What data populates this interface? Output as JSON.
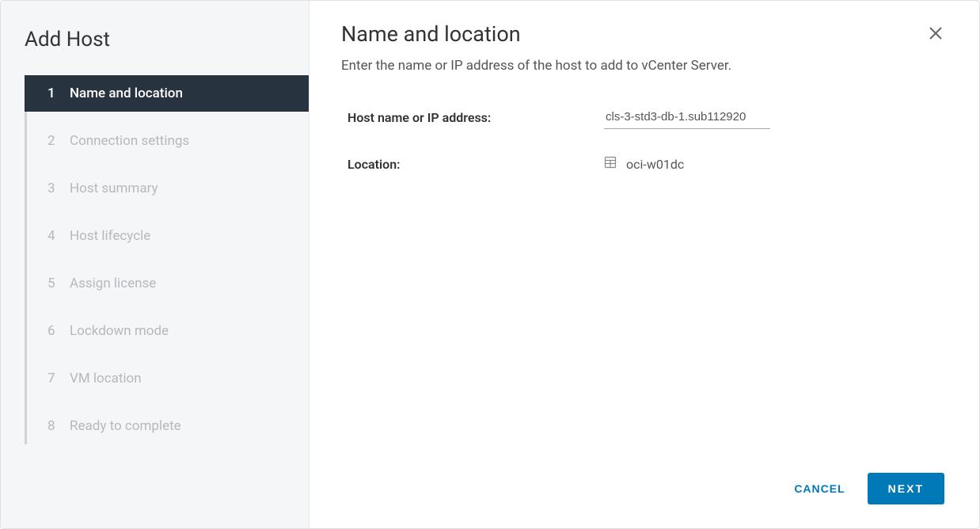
{
  "sidebar": {
    "title": "Add Host",
    "steps": [
      {
        "num": "1",
        "label": "Name and location",
        "active": true
      },
      {
        "num": "2",
        "label": "Connection settings",
        "active": false
      },
      {
        "num": "3",
        "label": "Host summary",
        "active": false
      },
      {
        "num": "4",
        "label": "Host lifecycle",
        "active": false
      },
      {
        "num": "5",
        "label": "Assign license",
        "active": false
      },
      {
        "num": "6",
        "label": "Lockdown mode",
        "active": false
      },
      {
        "num": "7",
        "label": "VM location",
        "active": false
      },
      {
        "num": "8",
        "label": "Ready to complete",
        "active": false
      }
    ]
  },
  "main": {
    "title": "Name and location",
    "description": "Enter the name or IP address of the host to add to vCenter Server.",
    "host_label": "Host name or IP address:",
    "host_value": "cls-3-std3-db-1.sub112920",
    "location_label": "Location:",
    "location_value": "oci-w01dc"
  },
  "footer": {
    "cancel": "CANCEL",
    "next": "NEXT"
  }
}
